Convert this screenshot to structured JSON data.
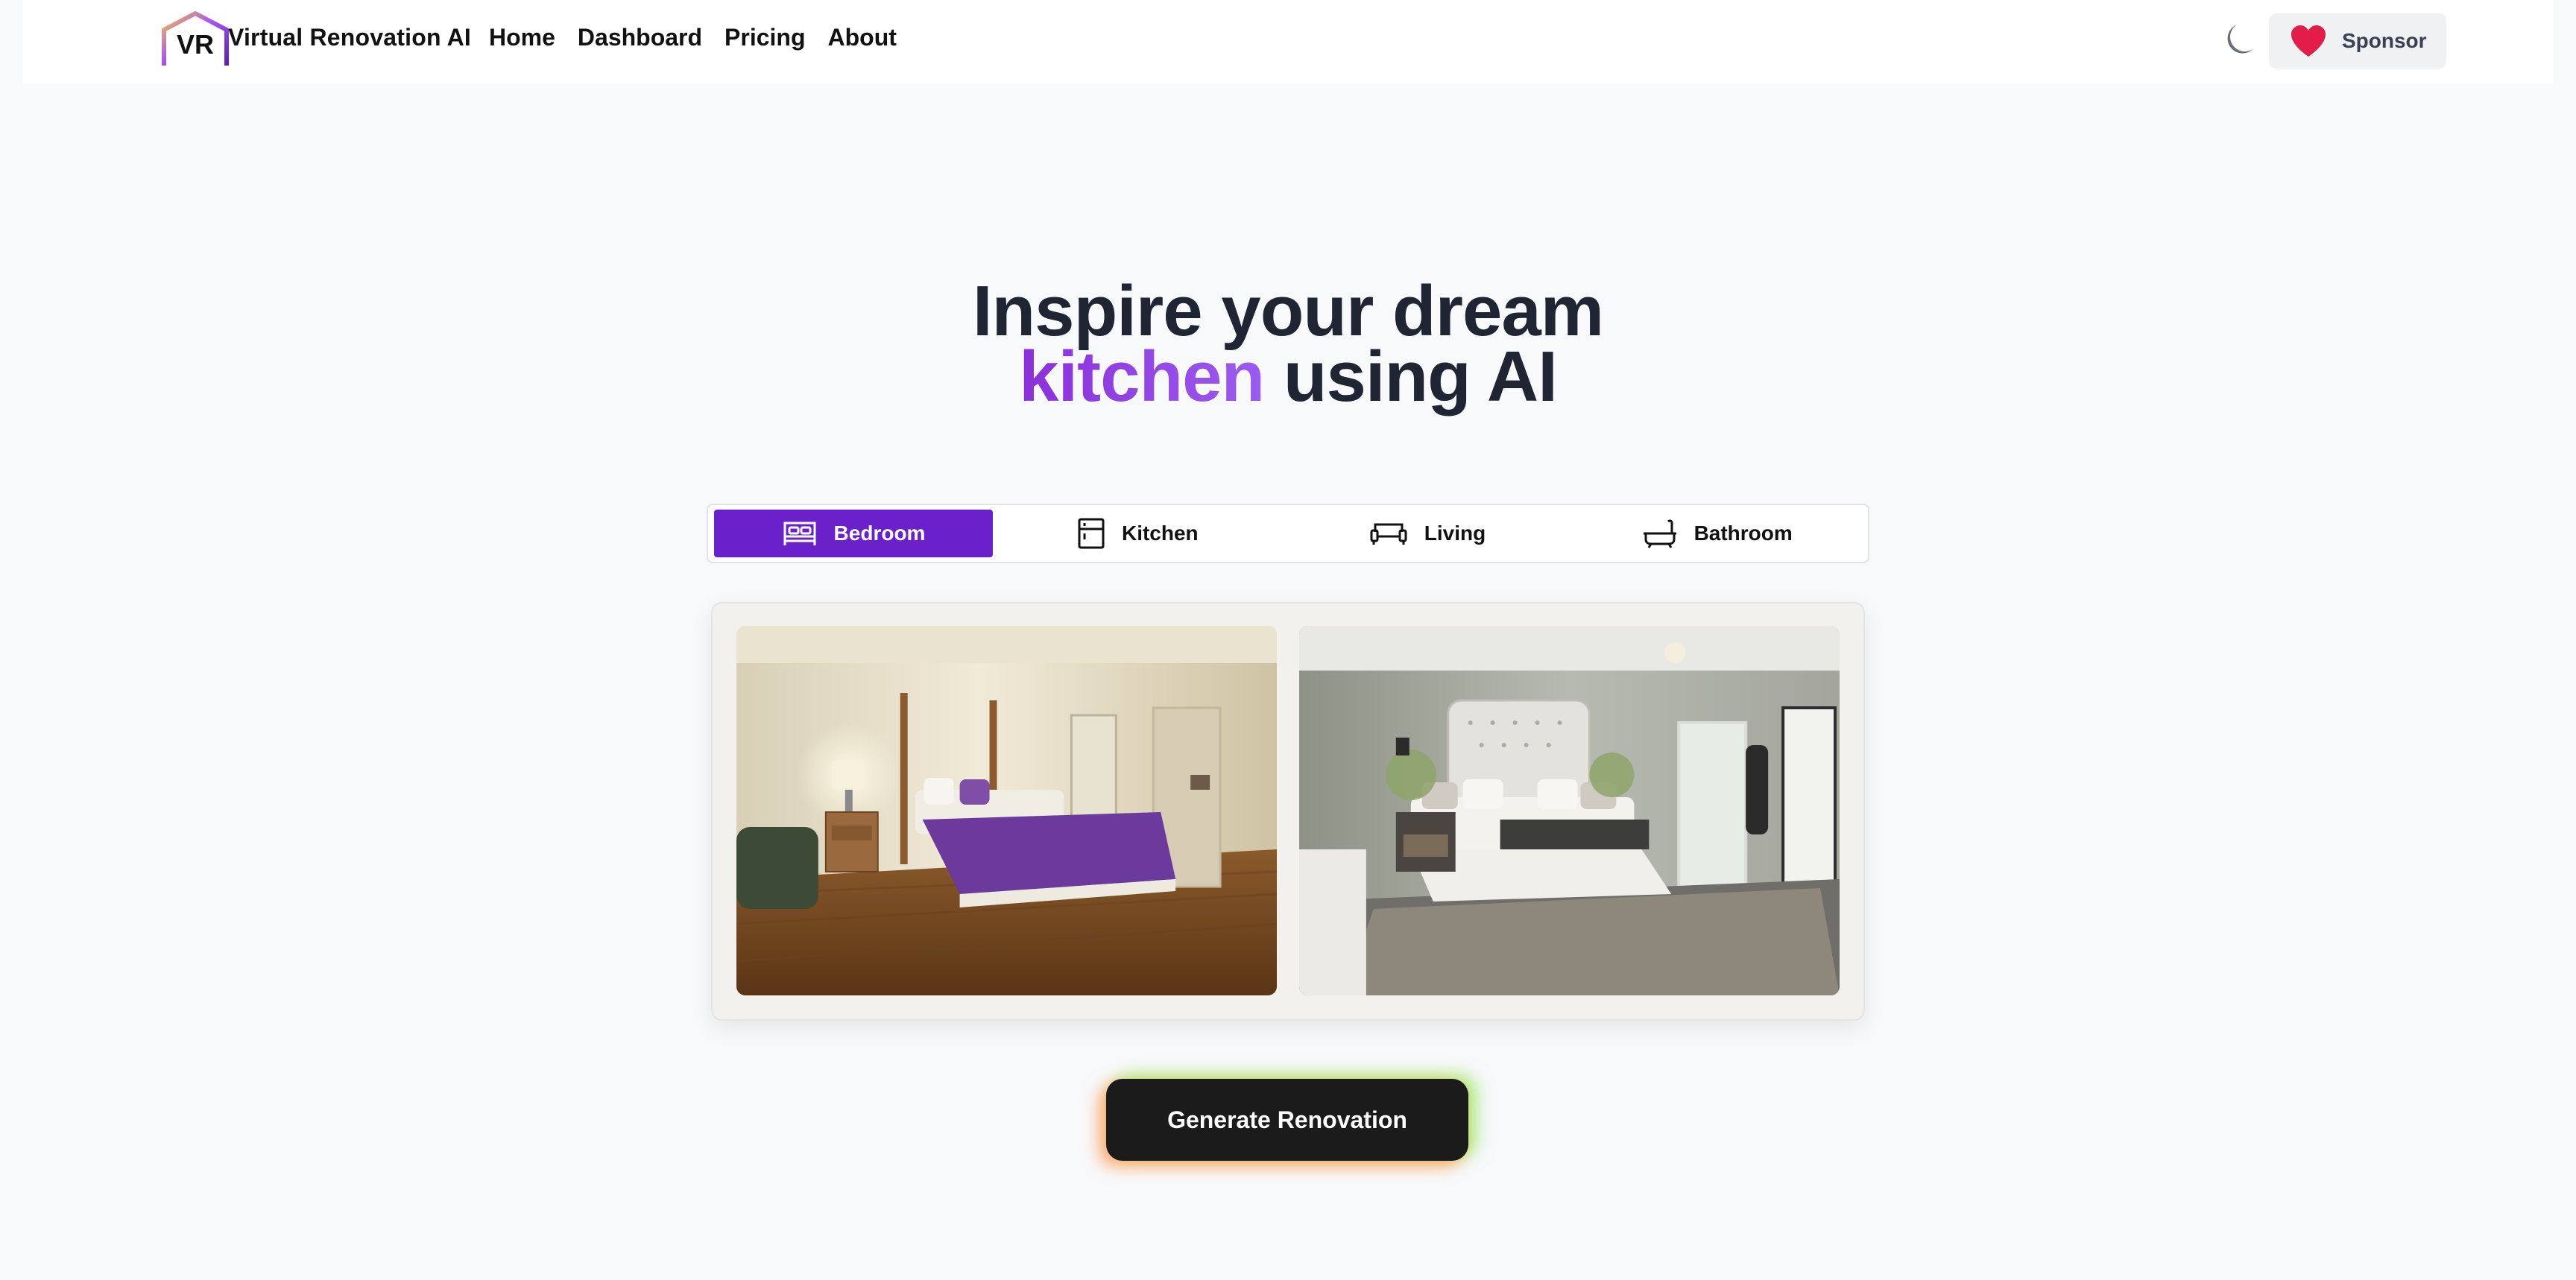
{
  "brand": {
    "name": "Virtual Renovation AI",
    "logo_text": "VR"
  },
  "nav": {
    "links": [
      {
        "label": "Home"
      },
      {
        "label": "Dashboard"
      },
      {
        "label": "Pricing"
      },
      {
        "label": "About"
      }
    ],
    "sponsor_label": "Sponsor",
    "theme_icon": "moon-icon"
  },
  "hero": {
    "line1": "Inspire your dream",
    "accent_word": "kitchen",
    "line2_rest": " using AI"
  },
  "tabs": [
    {
      "label": "Bedroom",
      "icon": "bed-icon",
      "active": true
    },
    {
      "label": "Kitchen",
      "icon": "fridge-icon",
      "active": false
    },
    {
      "label": "Living",
      "icon": "sofa-icon",
      "active": false
    },
    {
      "label": "Bathroom",
      "icon": "bathtub-icon",
      "active": false
    }
  ],
  "gallery": {
    "before_image": "bedroom-before-photo",
    "after_image": "bedroom-after-photo"
  },
  "cta": {
    "label": "Generate Renovation"
  },
  "colors": {
    "accent": "#6b21c9",
    "background": "#f8f9fb",
    "heart": "#e11d48",
    "text_dark": "#1f2533"
  }
}
